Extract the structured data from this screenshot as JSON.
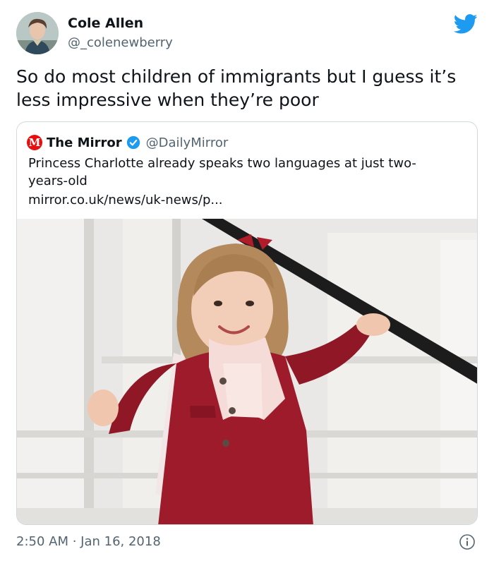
{
  "author": {
    "name": "Cole Allen",
    "handle": "@_colenewberry",
    "avatar_icon": "user-avatar"
  },
  "tweet": {
    "text_line1": "So do most children of immigrants but I guess it’s",
    "text_line2": "less impressive when they’re poor",
    "timestamp": "2:50 AM · Jan 16, 2018"
  },
  "quote": {
    "logo_letter": "M",
    "name": "The Mirror",
    "handle": "@DailyMirror",
    "verified_icon": "verified-badge-icon",
    "text_line1": "Princess Charlotte already speaks two languages at just two-",
    "text_line2": "years-old",
    "link": "mirror.co.uk/news/uk-news/p..."
  },
  "colors": {
    "twitter_blue": "#1d9bf0",
    "mirror_red": "#e90e0e",
    "coat_red": "#9e1b2b"
  },
  "icons": {
    "brand": "twitter-bird-icon",
    "info": "info-icon"
  }
}
